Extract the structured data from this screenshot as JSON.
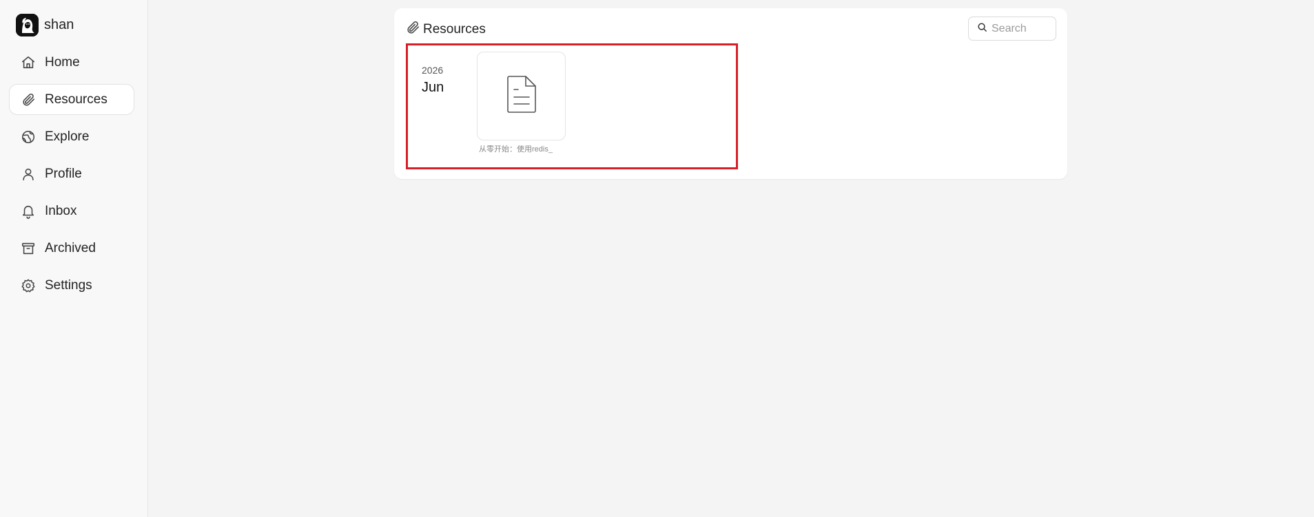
{
  "user": {
    "name": "shan",
    "avatar_icon": "avatar-portrait-icon"
  },
  "sidebar": {
    "items": [
      {
        "label": "Home",
        "icon": "home-icon"
      },
      {
        "label": "Resources",
        "icon": "paperclip-icon",
        "active": true
      },
      {
        "label": "Explore",
        "icon": "globe-icon"
      },
      {
        "label": "Profile",
        "icon": "user-icon"
      },
      {
        "label": "Inbox",
        "icon": "bell-icon"
      },
      {
        "label": "Archived",
        "icon": "archive-icon"
      },
      {
        "label": "Settings",
        "icon": "gear-icon"
      }
    ]
  },
  "main": {
    "title": "Resources",
    "title_icon": "paperclip-icon",
    "search": {
      "placeholder": "Search",
      "value": ""
    },
    "groups": [
      {
        "year": "2026",
        "month": "Jun",
        "files": [
          {
            "name": "从零开始：使用redis_",
            "icon": "document-icon"
          }
        ]
      }
    ]
  },
  "colors": {
    "highlight": "#d61f26",
    "background": "#f4f4f4",
    "sidebar_bg": "#f8f8f8",
    "card_bg": "#ffffff"
  }
}
